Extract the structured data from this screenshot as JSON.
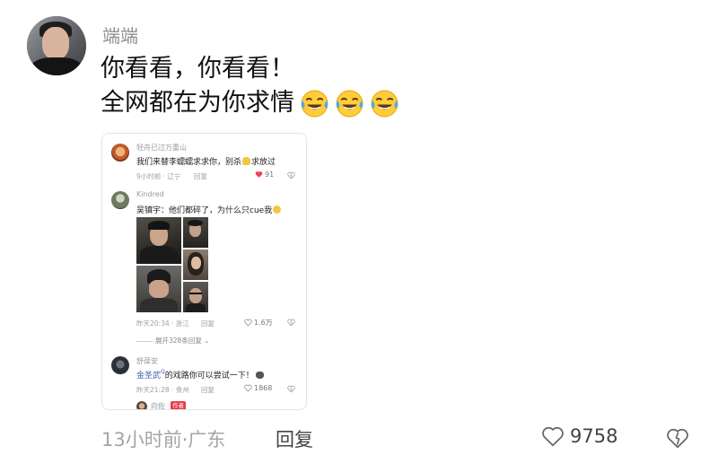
{
  "comment": {
    "username": "端端",
    "text_line1": "你看看，你看看！",
    "text_line2": "全网都在为你求情",
    "emoji_name": "laughing-crying-emoji",
    "time_location": "13小时前·广东",
    "reply_label": "回复",
    "like_count": "9758"
  },
  "screenshot": {
    "c1": {
      "name": "轻舟已过万重山",
      "text": "我们来替李蠕蠕求求你，别杀",
      "text_after_emoji": "求放过",
      "meta_time": "9小时前 · 辽宁",
      "reply": "回复",
      "likes": "91"
    },
    "c2": {
      "name": "Kindred",
      "text": "吴镇宇：他们都碎了，为什么只cue我",
      "meta_time": "昨天20:34 · 浙江",
      "reply": "回复",
      "likes": "1.6万",
      "expand": "展开328条回复"
    },
    "c3": {
      "name": "舒葆安",
      "mention": "金圣武",
      "text": "的戏路你可以尝试一下！",
      "meta_time": "昨天21:28 · 贵州",
      "reply": "回复",
      "likes": "1868"
    },
    "c4": {
      "name": "向佐",
      "badge": "作者"
    }
  },
  "colors": {
    "like_red": "#f0405a",
    "mention_blue": "#3b5fa8",
    "badge_red": "#ea3b4b"
  }
}
